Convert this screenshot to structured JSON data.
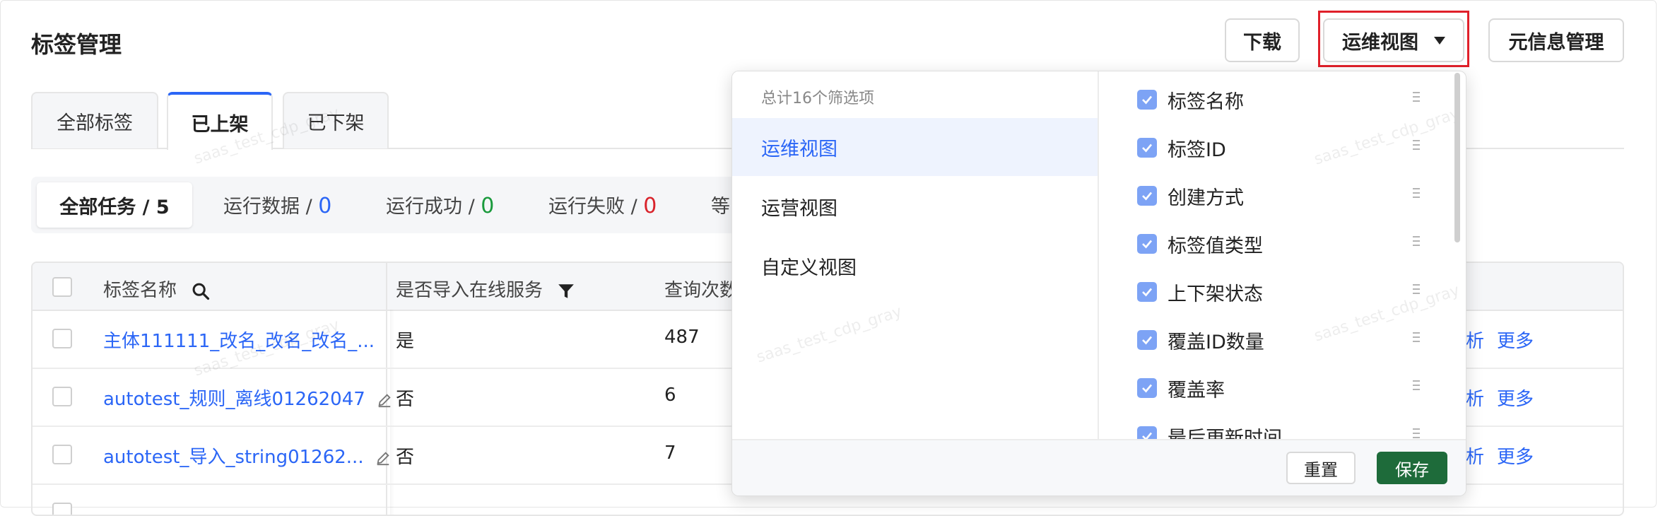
{
  "header": {
    "title": "标签管理",
    "download_label": "下载",
    "view_label": "运维视图",
    "meta_label": "元信息管理"
  },
  "tabs": [
    {
      "label": "全部标签"
    },
    {
      "label": "已上架"
    },
    {
      "label": "已下架"
    }
  ],
  "status": {
    "all_label": "全部任务 / 5",
    "running_label": "运行数据 / ",
    "running_count": "0",
    "success_label": "运行成功 / ",
    "success_count": "0",
    "failed_label": "运行失败 / ",
    "failed_count": "0",
    "more_label": "等"
  },
  "table": {
    "headers": {
      "name": "标签名称",
      "online": "是否导入在线服务",
      "query": "查询次数"
    },
    "rows": [
      {
        "name": "主体111111_改名_改名_改名_...",
        "online": "是",
        "query": "487",
        "action1": "析",
        "action2": "更多"
      },
      {
        "name": "autotest_规则_离线01262047",
        "online": "否",
        "query": "6",
        "action1": "析",
        "action2": "更多"
      },
      {
        "name": "autotest_导入_string01262...",
        "online": "否",
        "query": "7",
        "action1": "析",
        "action2": "更多"
      }
    ]
  },
  "popover": {
    "total": "总计16个筛选项",
    "views": [
      "运维视图",
      "运营视图",
      "自定义视图"
    ],
    "columns": [
      "标签名称",
      "标签ID",
      "创建方式",
      "标签值类型",
      "上下架状态",
      "覆盖ID数量",
      "覆盖率",
      "最后更新时间"
    ],
    "reset_label": "重置",
    "save_label": "保存"
  },
  "watermark": "saas_test_cdp_gray",
  "colors": {
    "accent": "#2b66f6",
    "save": "#1e6b3a",
    "highlight": "#e0202a",
    "success": "#1a9a3c",
    "danger": "#d9232b"
  }
}
